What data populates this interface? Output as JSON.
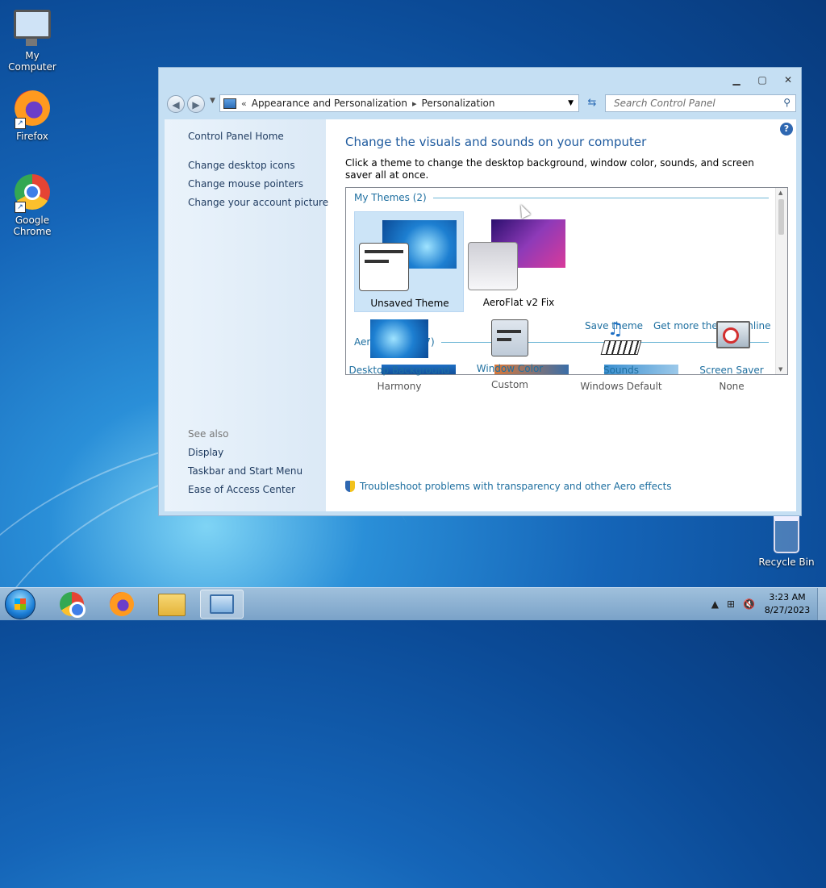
{
  "desktop": {
    "icons": [
      {
        "label": "My Computer"
      },
      {
        "label": "Firefox"
      },
      {
        "label": "Google Chrome"
      },
      {
        "label": "Recycle Bin"
      }
    ]
  },
  "window": {
    "address": {
      "history_marker": "«",
      "crumbs": [
        "Appearance and Personalization",
        "Personalization"
      ]
    },
    "search": {
      "placeholder": "Search Control Panel"
    },
    "sidebar": {
      "links": [
        "Control Panel Home",
        "Change desktop icons",
        "Change mouse pointers",
        "Change your account picture"
      ],
      "see_also_label": "See also",
      "see_also": [
        "Display",
        "Taskbar and Start Menu",
        "Ease of Access Center"
      ]
    },
    "main": {
      "heading": "Change the visuals and sounds on your computer",
      "description": "Click a theme to change the desktop background, window color, sounds, and screen saver all at once.",
      "my_themes_label": "My Themes (2)",
      "my_themes": [
        {
          "name": "Unsaved Theme",
          "selected": true
        },
        {
          "name": "AeroFlat v2 Fix",
          "selected": false
        }
      ],
      "save_theme": "Save theme",
      "get_more": "Get more themes online",
      "aero_themes_label": "Aero Themes (7)",
      "settings": [
        {
          "label": "Desktop Background",
          "value": "Harmony",
          "icon": "desktop-background-icon"
        },
        {
          "label": "Window Color",
          "value": "Custom",
          "icon": "window-color-icon"
        },
        {
          "label": "Sounds",
          "value": "Windows Default",
          "icon": "sounds-icon"
        },
        {
          "label": "Screen Saver",
          "value": "None",
          "icon": "screen-saver-icon"
        }
      ],
      "troubleshoot": "Troubleshoot problems with transparency and other Aero effects"
    }
  },
  "taskbar": {
    "clock": {
      "time": "3:23 AM",
      "date": "8/27/2023"
    }
  }
}
